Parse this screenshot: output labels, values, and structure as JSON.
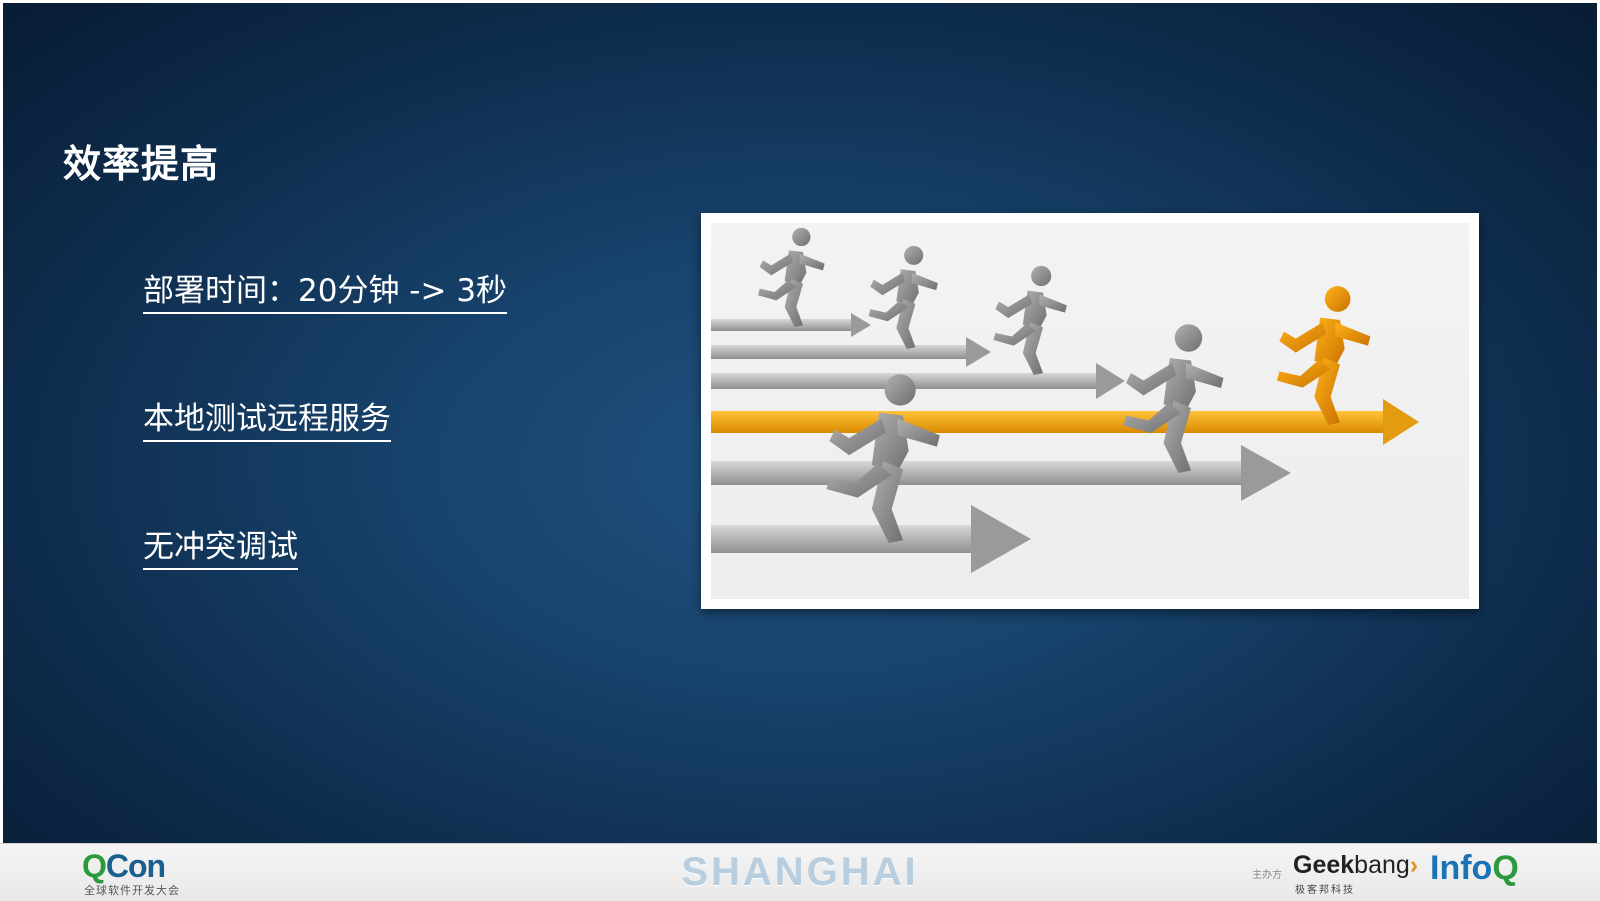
{
  "slide": {
    "title": "效率提高",
    "bullets": [
      {
        "text": "部署时间：20分钟 -> 3秒"
      },
      {
        "text": "本地测试远程服务"
      },
      {
        "text": "无冲突调试"
      }
    ],
    "image": {
      "description_icon": "runners-race-arrows-icon"
    }
  },
  "footer": {
    "qcon": {
      "q": "Q",
      "con": "Con",
      "subtitle": "全球软件开发大会"
    },
    "city": "SHANGHAI",
    "organizer_label": "主办方",
    "geekbang": {
      "geek": "Geek",
      "bang": "bang",
      "arrow": "›",
      "subtitle": "极客邦科技"
    },
    "infoq": {
      "info": "Info",
      "q": "Q"
    }
  },
  "colors": {
    "background": "#17426b",
    "accent_orange": "#e6901c",
    "qcon_green": "#2a9a3a",
    "infoq_blue": "#1a73b5"
  }
}
